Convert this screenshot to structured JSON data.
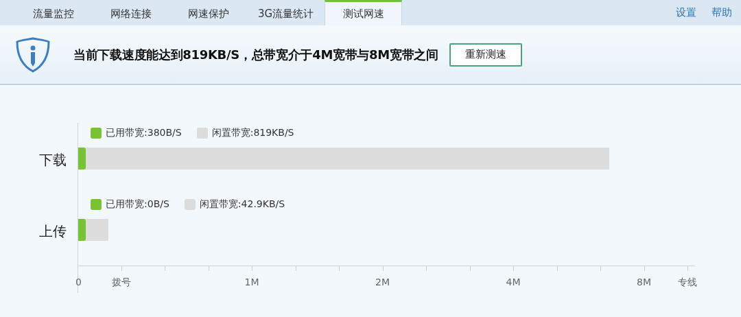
{
  "tabs": [
    {
      "label": "流量监控",
      "selected": false
    },
    {
      "label": "网络连接",
      "selected": false
    },
    {
      "label": "网速保护",
      "selected": false
    },
    {
      "label": "3G流量统计",
      "selected": false
    },
    {
      "label": "测试网速",
      "selected": true
    }
  ],
  "links": [
    "设置",
    "帮助"
  ],
  "banner": {
    "message": "当前下载速度能达到819KB/S，总带宽介于4M宽带与8M宽带之间",
    "button": "重新测速"
  },
  "rows": [
    {
      "label": "下载",
      "used": {
        "legend": "已用带宽:",
        "value": "380B/S",
        "level": 0.012
      },
      "idle": {
        "legend": "闲置带宽:",
        "value": "819KB/S",
        "level": 0.86
      }
    },
    {
      "label": "上传",
      "used": {
        "legend": "已用带宽:",
        "value": "0B/S",
        "level": 0.012
      },
      "idle": {
        "legend": "闲置带宽:",
        "value": "42.9KB/S",
        "level": 0.049
      }
    }
  ],
  "axis_labels": [
    "0",
    "拨号",
    "1M",
    "2M",
    "4M",
    "8M",
    "专线"
  ]
}
